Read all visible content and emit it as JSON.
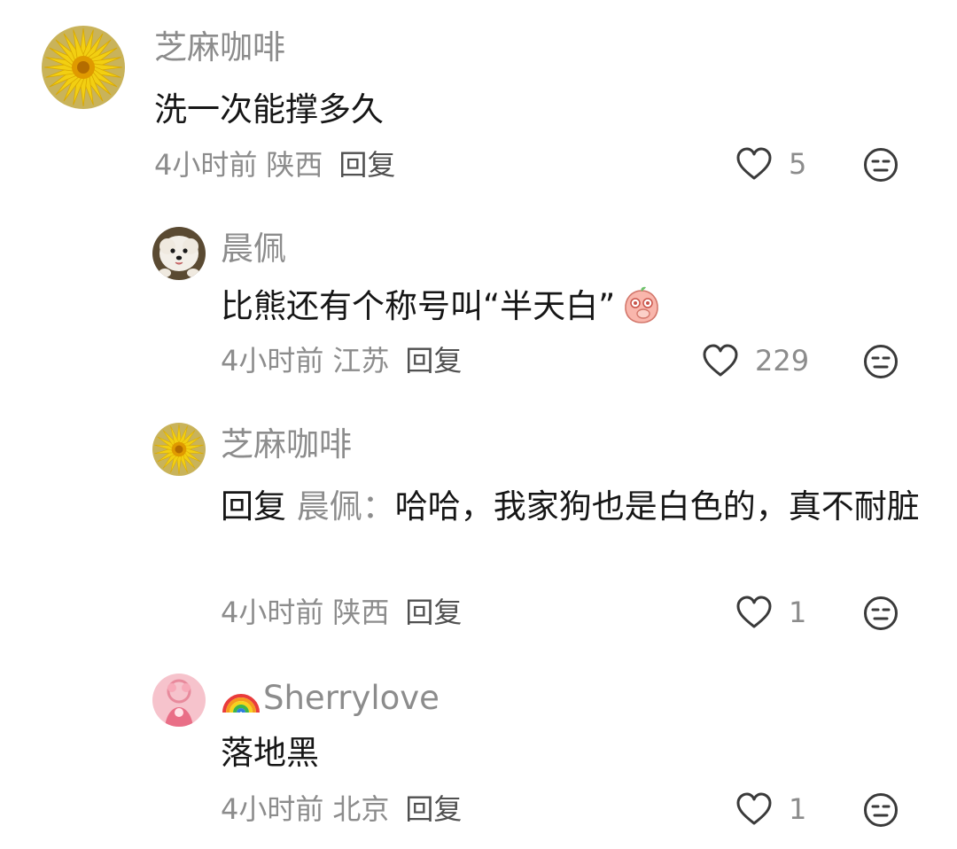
{
  "comments": [
    {
      "username": "芝麻咖啡",
      "text": "洗一次能撑多久",
      "time": "4小时前",
      "region": "陕西",
      "reply_label": "回复",
      "likes": "5"
    },
    {
      "username": "晨佩",
      "text": "比熊还有个称号叫“半天白”",
      "time": "4小时前",
      "region": "江苏",
      "reply_label": "回复",
      "likes": "229"
    },
    {
      "username": "芝麻咖啡",
      "reply_prefix": "回复",
      "mention": "晨佩：",
      "text": "哈哈，我家狗也是白色的，真不耐脏",
      "time": "4小时前",
      "region": "陕西",
      "reply_label": "回复",
      "likes": "1"
    },
    {
      "username": "Sherrylove",
      "text": "落地黑",
      "time": "4小时前",
      "region": "北京",
      "reply_label": "回复",
      "likes": "1"
    }
  ],
  "icons": {
    "like": "heart-outline-icon",
    "dislike": "meh-face-icon"
  },
  "colors": {
    "primary_text": "#161616",
    "secondary_text": "#8c8c8c",
    "icon": "#3a3a3a"
  }
}
